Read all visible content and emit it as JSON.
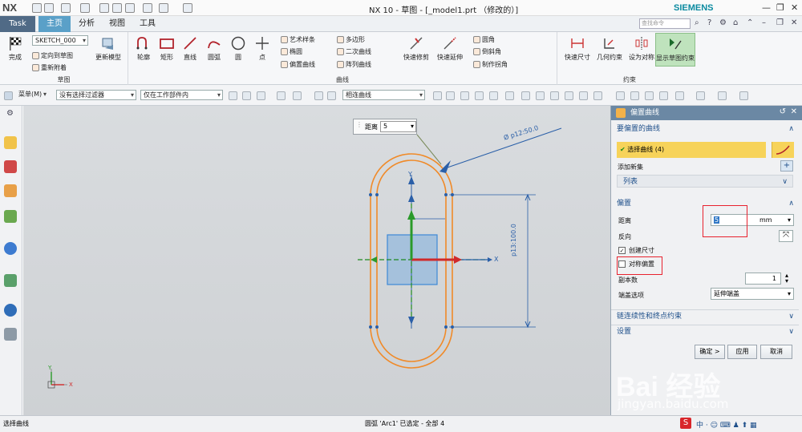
{
  "window": {
    "logo": "NX",
    "title": "NX 10 - 草图 - [_model1.prt （修改的）]",
    "brand": "SIEMENS"
  },
  "tabs": [
    "Task",
    "主页",
    "分析",
    "视图",
    "工具"
  ],
  "search": {
    "placeholder": "查找命令"
  },
  "ribbon": {
    "finish": "完成",
    "sketch_name": "SKETCH_000",
    "orient": "定向到草图",
    "reattach": "重新附着",
    "update_model": "更新模型",
    "sketch_group": "草图",
    "profile": "轮廓",
    "rect": "矩形",
    "line": "直线",
    "arc": "圆弧",
    "circle": "圆",
    "point": "点",
    "art_spline": "艺术样条",
    "ellipse": "椭圆",
    "offset_curve": "偏置曲线",
    "polygon": "多边形",
    "conic": "二次曲线",
    "pattern_curve": "阵列曲线",
    "quick_trim": "快速修剪",
    "quick_extend": "快速延伸",
    "fillet": "圆角",
    "chamfer": "倒斜角",
    "make_corner": "制作拐角",
    "curve_group": "曲线",
    "rapid_dim": "快速尺寸",
    "geo_constraint": "几何约束",
    "set_symmetric": "设为对称",
    "show_constraints": "显示草图约束",
    "constraint_group": "约束"
  },
  "toolbar2": {
    "menu": "菜单(M)",
    "filter": "没有选择过滤器",
    "scope": "仅在工作部件内",
    "curve_rule": "相连曲线"
  },
  "canvas": {
    "distance_label": "距离",
    "distance_value": "5",
    "dim_arc": "Ø p12:50.0",
    "dim_vertical": "p13:100.0",
    "axis_x": "X",
    "axis_y": "Y"
  },
  "panel": {
    "title": "偏置曲线",
    "sect_curve": "要偏置的曲线",
    "select_curve": "选择曲线 (4)",
    "add_new_set": "添加新集",
    "list": "列表",
    "sect_offset": "偏置",
    "distance": "距离",
    "distance_value": "5",
    "unit": "mm",
    "reverse": "反向",
    "create_dim": "创建尺寸",
    "symmetric_offset": "对称偏置",
    "copies": "副本数",
    "copies_value": "1",
    "cap_options": "端盖选项",
    "cap_value": "延伸端盖",
    "sect_chain": "链连续性和终点约束",
    "sect_settings": "设置",
    "ok": "确定 >",
    "apply": "应用",
    "cancel": "取消"
  },
  "status": {
    "left": "选择曲线",
    "center": "圆弧 'Arc1' 已选定 - 全部 4"
  },
  "watermark": {
    "brand": "Bai 经验",
    "url": "jingyan.baidu.com"
  }
}
